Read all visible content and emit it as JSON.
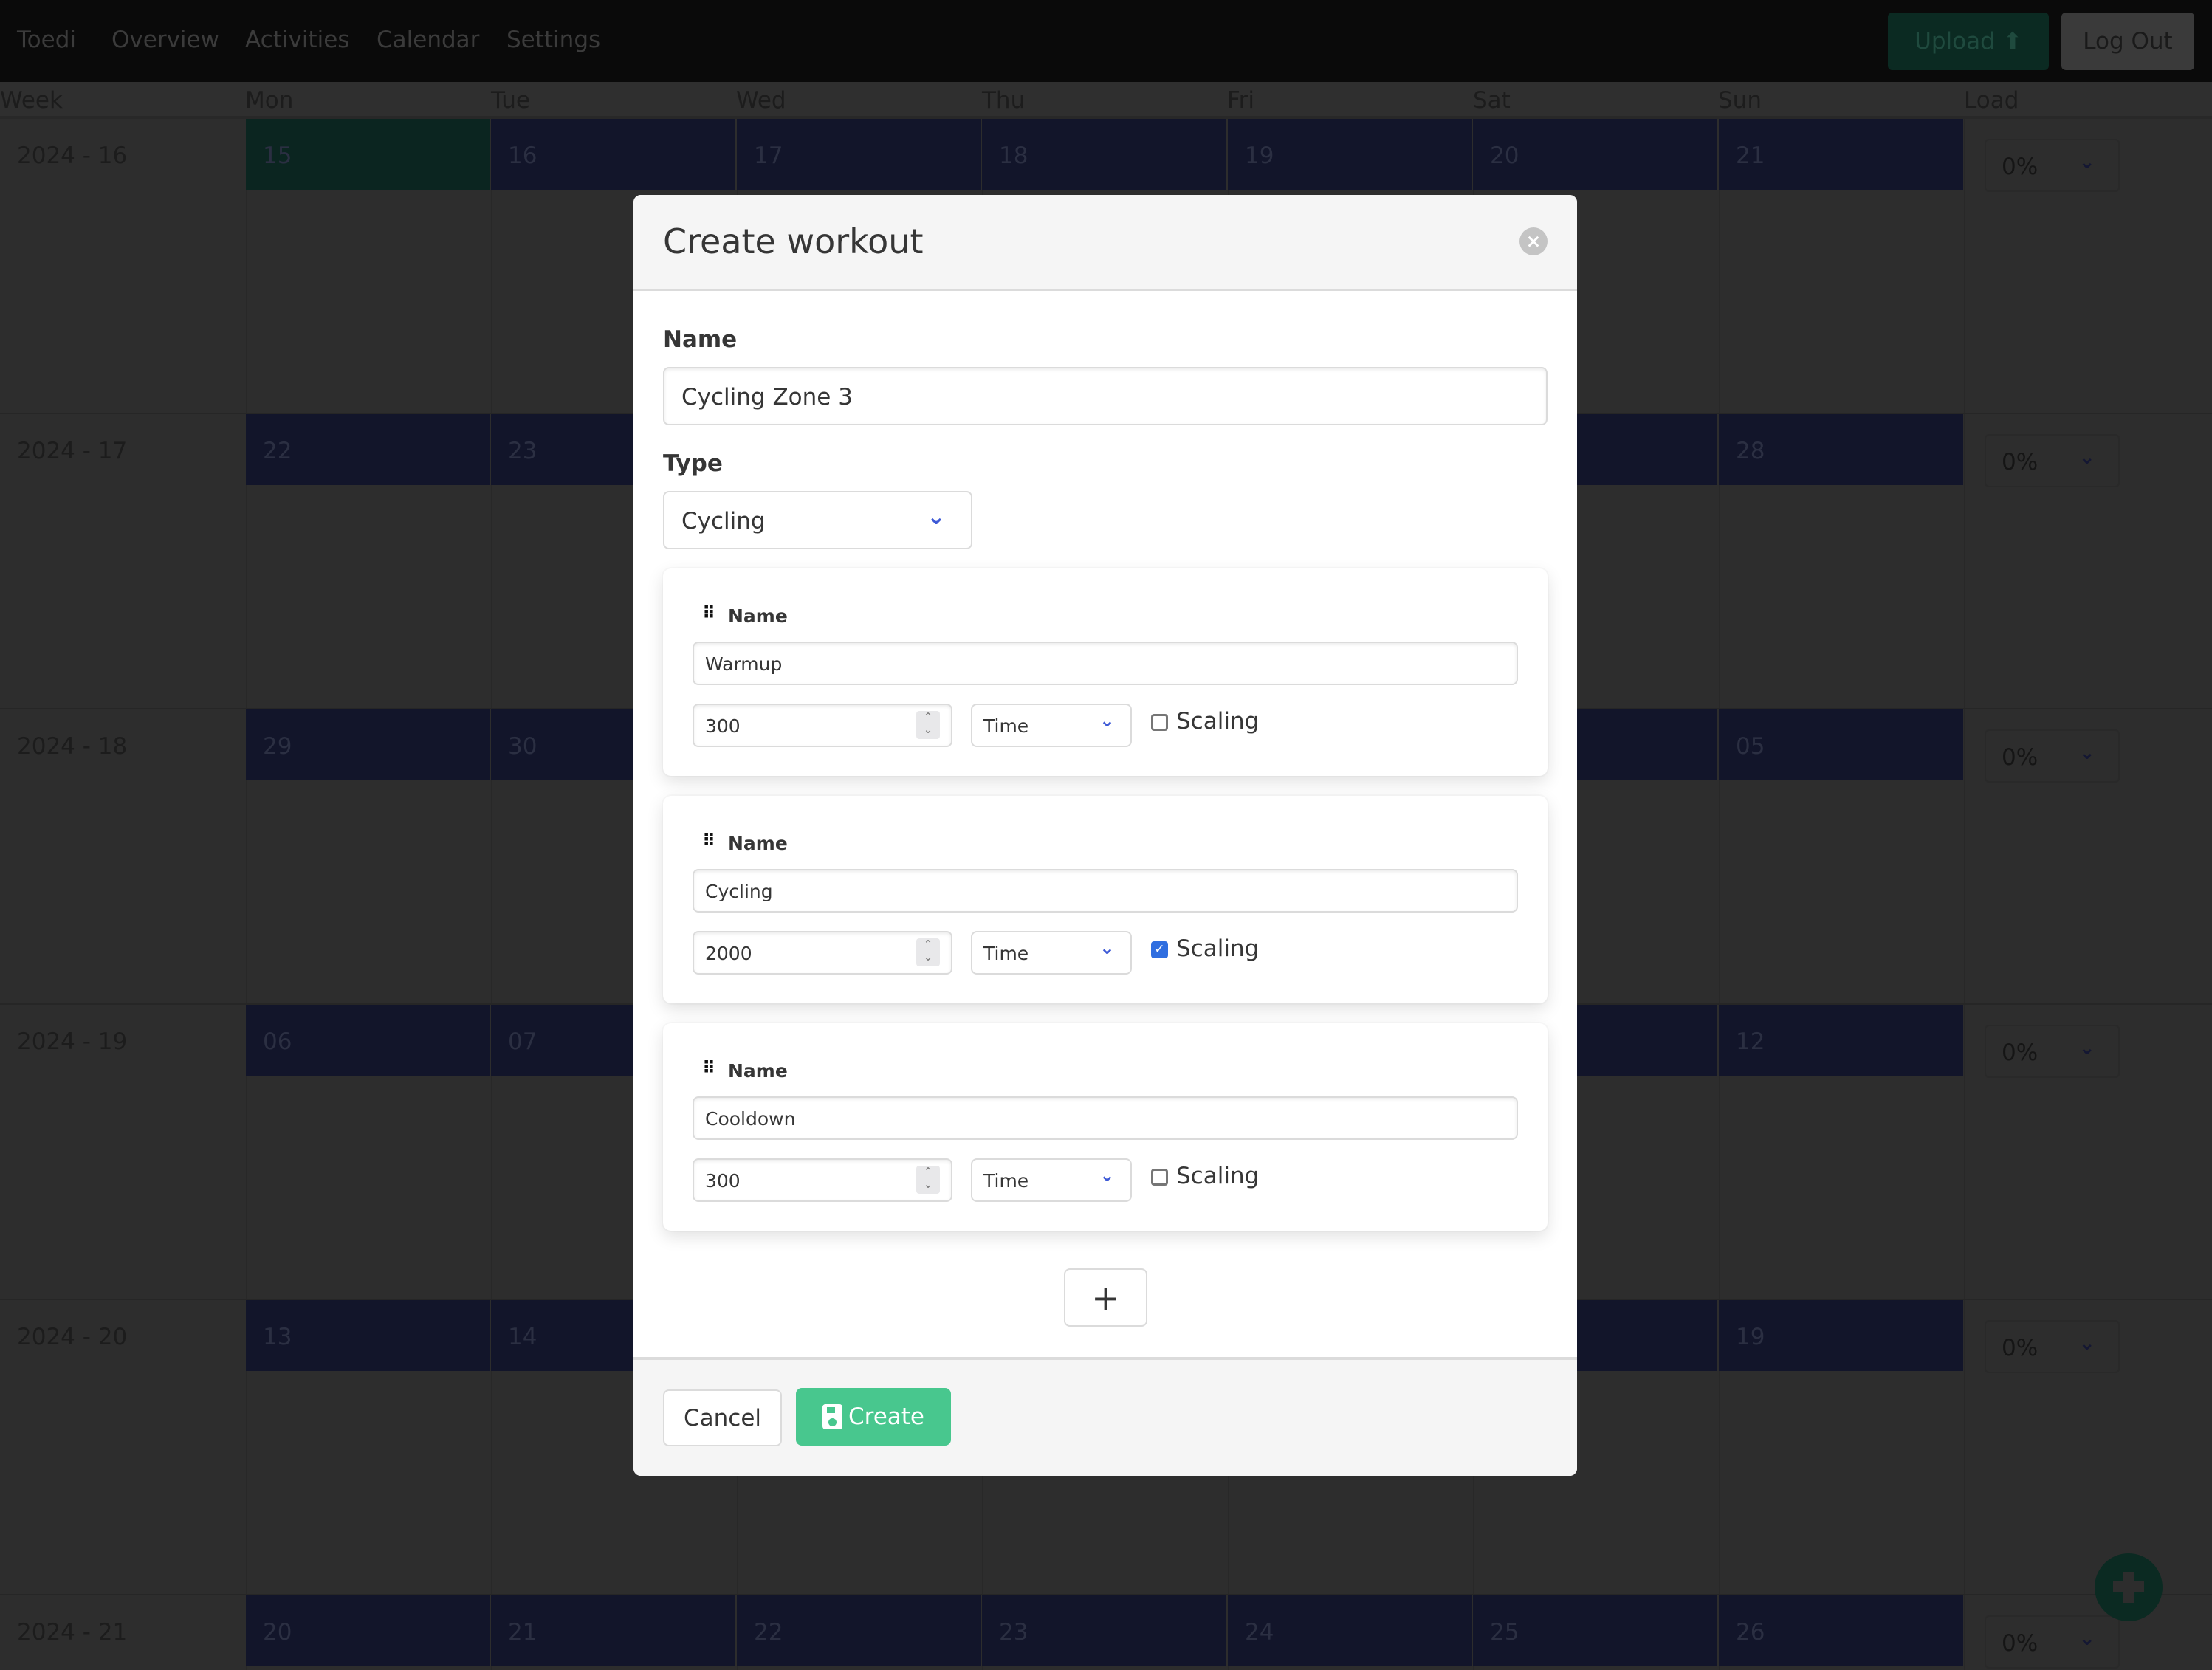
{
  "nav": {
    "brand": "Toedi",
    "links": [
      "Overview",
      "Activities",
      "Calendar",
      "Settings"
    ],
    "upload_label": "Upload",
    "logout_label": "Log Out"
  },
  "calendar": {
    "headers": [
      "Week",
      "Mon",
      "Tue",
      "Wed",
      "Thu",
      "Fri",
      "Sat",
      "Sun",
      "Load"
    ],
    "weeks": [
      {
        "label": "2024 - 16",
        "days": [
          "15",
          "16",
          "17",
          "18",
          "19",
          "20",
          "21"
        ],
        "load": "0%",
        "today_index": 0
      },
      {
        "label": "2024 - 17",
        "days": [
          "22",
          "23",
          "",
          "",
          "",
          "",
          "28"
        ],
        "load": "0%"
      },
      {
        "label": "2024 - 18",
        "days": [
          "29",
          "30",
          "",
          "",
          "",
          "",
          "05"
        ],
        "load": "0%"
      },
      {
        "label": "2024 - 19",
        "days": [
          "06",
          "07",
          "",
          "",
          "",
          "",
          "12"
        ],
        "load": "0%"
      },
      {
        "label": "2024 - 20",
        "days": [
          "13",
          "14",
          "",
          "",
          "",
          "",
          "19"
        ],
        "load": "0%"
      },
      {
        "label": "2024 - 21",
        "days": [
          "20",
          "21",
          "22",
          "23",
          "24",
          "25",
          "26"
        ],
        "load": "0%"
      }
    ]
  },
  "modal": {
    "title": "Create workout",
    "name_label": "Name",
    "name_value": "Cycling Zone 3",
    "type_label": "Type",
    "type_value": "Cycling",
    "steps": [
      {
        "label": "Name",
        "name": "Warmup",
        "amount": "300",
        "unit": "Time",
        "scaling_label": "Scaling",
        "scaling": false
      },
      {
        "label": "Name",
        "name": "Cycling",
        "amount": "2000",
        "unit": "Time",
        "scaling_label": "Scaling",
        "scaling": true
      },
      {
        "label": "Name",
        "name": "Cooldown",
        "amount": "300",
        "unit": "Time",
        "scaling_label": "Scaling",
        "scaling": false
      }
    ],
    "add_step_label": "+",
    "cancel_label": "Cancel",
    "create_label": "Create"
  },
  "colors": {
    "accent": "#48c78e",
    "checkbox": "#2f6ee0",
    "select_chevron": "#3e5ad6",
    "overlay_day": "#12152a",
    "overlay_today": "#0b2520"
  }
}
